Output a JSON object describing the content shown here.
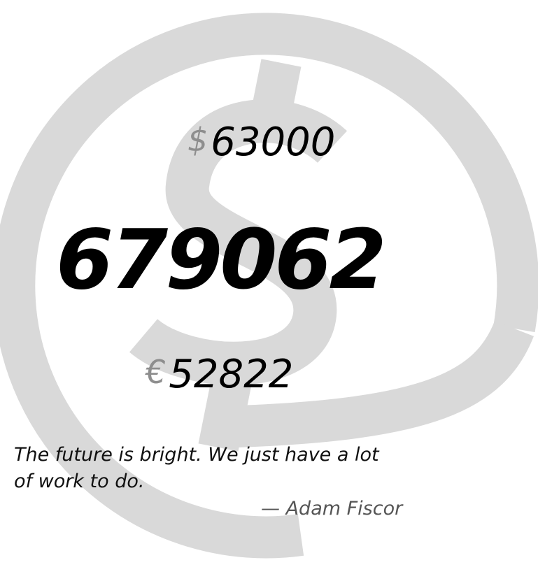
{
  "amounts": {
    "usd": {
      "symbol": "$",
      "value": "63000"
    },
    "total": "679062",
    "eur": {
      "symbol": "€",
      "value": "52822"
    }
  },
  "quote": {
    "text": "The future is bright. We just have a lot of work to do.",
    "author": "— Adam Fiscor"
  },
  "colors": {
    "background": "#ffffff",
    "watermark": "#d9d9d9",
    "currency_symbol": "#8e8e8e",
    "text": "#000000",
    "author": "#555555"
  },
  "icons": {
    "background": "currency-watermark-icon"
  }
}
